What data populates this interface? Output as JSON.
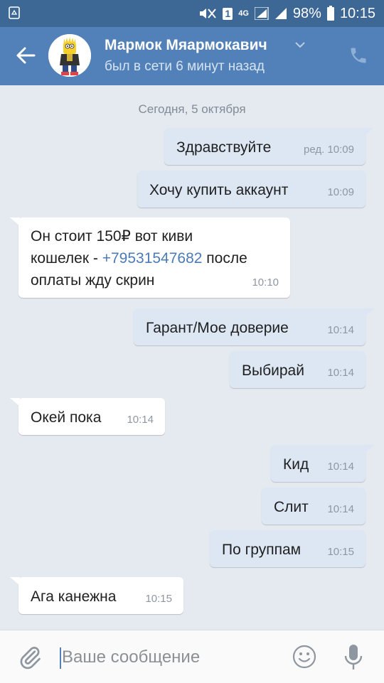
{
  "status_bar": {
    "sim_badge": "1",
    "network": "4G",
    "battery": "98%",
    "time": "10:15"
  },
  "header": {
    "contact_name": "Мармок Мяармокавич",
    "contact_status": "был в сети 6 минут назад"
  },
  "chat": {
    "date_separator": "Сегодня, 5 октября",
    "messages": [
      {
        "dir": "out",
        "text": "Здравствуйте",
        "time": "ред. 10:09"
      },
      {
        "dir": "out",
        "text": "Хочу купить аккаунт",
        "time": "10:09"
      },
      {
        "dir": "in",
        "line1": "Он стоит 150₽ вот киви",
        "line2_pre": "кошелек - ",
        "line2_link": "+79531547682",
        "line2_post": " после",
        "line3": "оплаты жду скрин",
        "time": "10:10"
      },
      {
        "dir": "out",
        "text": "Гарант/Мое доверие",
        "time": "10:14"
      },
      {
        "dir": "out",
        "text": "Выбирай",
        "time": "10:14"
      },
      {
        "dir": "in",
        "text": "Окей пока",
        "time": "10:14"
      },
      {
        "dir": "out",
        "text": "Кид",
        "time": "10:14"
      },
      {
        "dir": "out",
        "text": "Слит",
        "time": "10:14"
      },
      {
        "dir": "out",
        "text": "По группам",
        "time": "10:15"
      },
      {
        "dir": "in",
        "text": "Ага канежна",
        "time": "10:15"
      }
    ]
  },
  "composer": {
    "placeholder": "Ваше сообщение"
  },
  "icons": {
    "status_left": "recycle-icon",
    "back": "arrow-left-icon",
    "dropdown": "chevron-down-icon",
    "call": "phone-icon",
    "attach": "paperclip-icon",
    "emoji": "smile-icon",
    "voice": "microphone-icon"
  },
  "colors": {
    "status_bar": "#3d6895",
    "header": "#5181b8",
    "chat_background": "#e5eaf0",
    "outgoing_bubble": "#dde7f3",
    "incoming_bubble": "#ffffff",
    "link": "#4a7bb7"
  }
}
